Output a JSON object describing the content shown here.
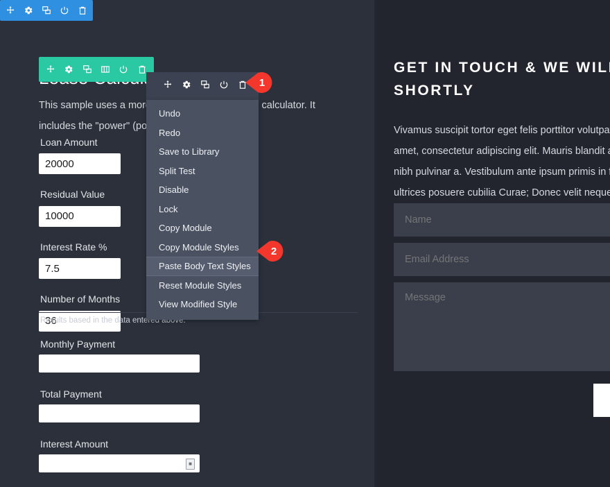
{
  "panels": {
    "left_bg": "#2b303b",
    "right_bg": "#22252e"
  },
  "toolbars": {
    "blue": {
      "color": "#2f8fe0",
      "icons": [
        "move-icon",
        "gear-icon",
        "duplicate-icon",
        "power-icon",
        "trash-icon"
      ]
    },
    "green": {
      "color": "#2bc8a4",
      "icons": [
        "move-icon",
        "gear-icon",
        "duplicate-icon",
        "columns-icon",
        "power-icon",
        "trash-icon"
      ]
    },
    "dark": {
      "color": "#3c4251",
      "icons": [
        "move-icon",
        "gear-icon",
        "duplicate-icon",
        "power-icon",
        "trash-icon"
      ]
    }
  },
  "context_menu": {
    "items": [
      {
        "label": "Undo",
        "highlighted": false
      },
      {
        "label": "Redo",
        "highlighted": false
      },
      {
        "label": "Save to Library",
        "highlighted": false
      },
      {
        "label": "Split Test",
        "highlighted": false
      },
      {
        "label": "Disable",
        "highlighted": false
      },
      {
        "label": "Lock",
        "highlighted": false
      },
      {
        "label": "Copy Module",
        "highlighted": false
      },
      {
        "label": "Copy Module Styles",
        "highlighted": false
      },
      {
        "label": "Paste Body Text Styles",
        "highlighted": true
      },
      {
        "label": "Reset Module Styles",
        "highlighted": false
      },
      {
        "label": "View Modified Style",
        "highlighted": false
      }
    ]
  },
  "markers": [
    {
      "number": "1",
      "color": "#f4372c"
    },
    {
      "number": "2",
      "color": "#f4372c"
    }
  ],
  "calculator": {
    "title": "Lease Calculator",
    "intro": "This sample uses a more complex formula for the calculator. It includes the \"power\" (pow) and \"pr",
    "fields": [
      {
        "label": "Loan Amount",
        "value": "20000"
      },
      {
        "label": "Residual Value",
        "value": "10000"
      },
      {
        "label": "Interest Rate %",
        "value": "7.5"
      },
      {
        "label": "Number of Months",
        "value": "36"
      }
    ],
    "results_note": "Results based in the data entered above:",
    "results": [
      {
        "label": "Monthly Payment",
        "value": ""
      },
      {
        "label": "Total Payment",
        "value": ""
      },
      {
        "label": "Interest Amount",
        "value": ""
      }
    ]
  },
  "contact": {
    "heading_line1": "GET IN TOUCH & WE WILL C",
    "heading_line2": "SHORTLY",
    "body": "Vivamus suscipit tortor eget felis porttitor volutpat. L amet, consectetur adipiscing elit. Mauris blandit aliqu nibh pulvinar a. Vestibulum ante ipsum primis in fauc ultrices posuere cubilia Curae; Donec velit neque",
    "body_lines": [
      "Vivamus suscipit tortor eget felis porttitor volutpat. L",
      "amet, consectetur adipiscing elit. Mauris blandit aliqu",
      "nibh pulvinar a. Vestibulum ante ipsum primis in fauc",
      "ultrices posuere cubilia Curae; Donec velit neque"
    ],
    "fields": [
      {
        "name": "name",
        "placeholder": "Name",
        "value": ""
      },
      {
        "name": "email",
        "placeholder": "Email Address",
        "value": ""
      }
    ],
    "message": {
      "placeholder": "Message",
      "value": ""
    },
    "submit_label": ""
  }
}
